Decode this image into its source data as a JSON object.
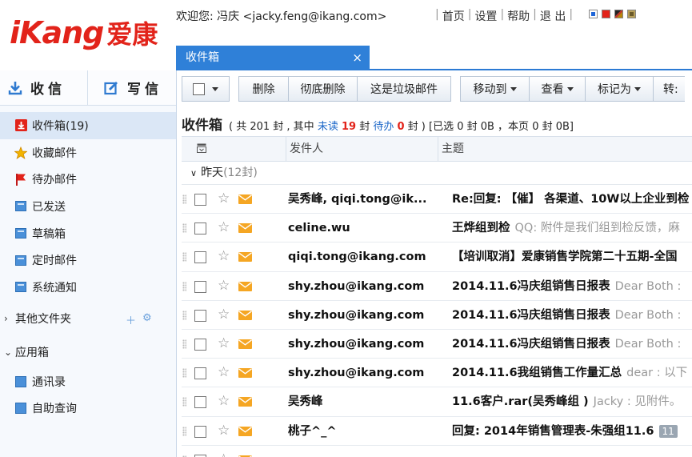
{
  "header": {
    "logo_latin": "iKang",
    "logo_cn": "爱康",
    "welcome": "欢迎您: 冯庆 <jacky.feng@ikang.com>",
    "links": [
      "首页",
      "设置",
      "帮助",
      "退 出"
    ],
    "skin_colors": [
      "#1f66d8",
      "#e2231a",
      "#c0392b",
      "#b8860b"
    ]
  },
  "tab": {
    "label": "收件箱",
    "close": "×"
  },
  "sidebar": {
    "receive": "收信",
    "write": "写信",
    "folders": [
      {
        "label": "收件箱(19)",
        "icon": "inbox-icon"
      },
      {
        "label": "收藏邮件",
        "icon": "star-icon"
      },
      {
        "label": "待办邮件",
        "icon": "flag-icon"
      },
      {
        "label": "已发送",
        "icon": "folder-icon"
      },
      {
        "label": "草稿箱",
        "icon": "folder-icon"
      },
      {
        "label": "定时邮件",
        "icon": "folder-icon"
      },
      {
        "label": "系统通知",
        "icon": "folder-icon"
      }
    ],
    "other_folders": "其他文件夹",
    "app_box": "应用箱",
    "apps": [
      "通讯录",
      "自助查询"
    ]
  },
  "toolbar": {
    "delete": "删除",
    "delete_permanent": "彻底删除",
    "spam": "这是垃圾邮件",
    "move_to": "移动到",
    "view": "查看",
    "mark_as": "标记为",
    "forward": "转:"
  },
  "summary": {
    "title": "收件箱",
    "p1": "( 共 201 封 , 其中 ",
    "unread_label": "未读",
    "unread_count": "19",
    "p2": " 封 ",
    "todo_label": "待办",
    "todo_count": "0",
    "p3": " 封 ) [已选 0 封 0B ，本页 0 封 0B]"
  },
  "list": {
    "col_sender": "发件人",
    "col_subject": "主题",
    "group_label": "昨天",
    "group_count": "(12封)",
    "rows": [
      {
        "sender": "吴秀峰, qiqi.tong@ik...",
        "subject": "Re:回复: 【催】 各渠道、10W以上企业到检",
        "preview": "",
        "badge": ""
      },
      {
        "sender": "celine.wu",
        "subject": "王烨组到检",
        "preview": "QQ: 附件是我们组到检反馈，麻",
        "badge": ""
      },
      {
        "sender": "qiqi.tong@ikang.com",
        "subject": "【培训取消】爱康销售学院第二十五期-全国",
        "preview": "",
        "badge": ""
      },
      {
        "sender": "shy.zhou@ikang.com",
        "subject": "2014.11.6冯庆组销售日报表",
        "preview": "Dear Both :",
        "badge": ""
      },
      {
        "sender": "shy.zhou@ikang.com",
        "subject": "2014.11.6冯庆组销售日报表",
        "preview": "Dear Both :",
        "badge": ""
      },
      {
        "sender": "shy.zhou@ikang.com",
        "subject": "2014.11.6冯庆组销售日报表",
        "preview": "Dear Both :",
        "badge": ""
      },
      {
        "sender": "shy.zhou@ikang.com",
        "subject": "2014.11.6我组销售工作量汇总",
        "preview": "dear :  以下",
        "badge": ""
      },
      {
        "sender": "吴秀峰",
        "subject": "11.6客户.rar(吴秀峰组 )",
        "preview": "Jacky :  见附件。",
        "badge": ""
      },
      {
        "sender": "桃子^_^",
        "subject": "回复: 2014年销售管理表-朱强组11.6",
        "preview": "",
        "badge": "11"
      }
    ]
  }
}
